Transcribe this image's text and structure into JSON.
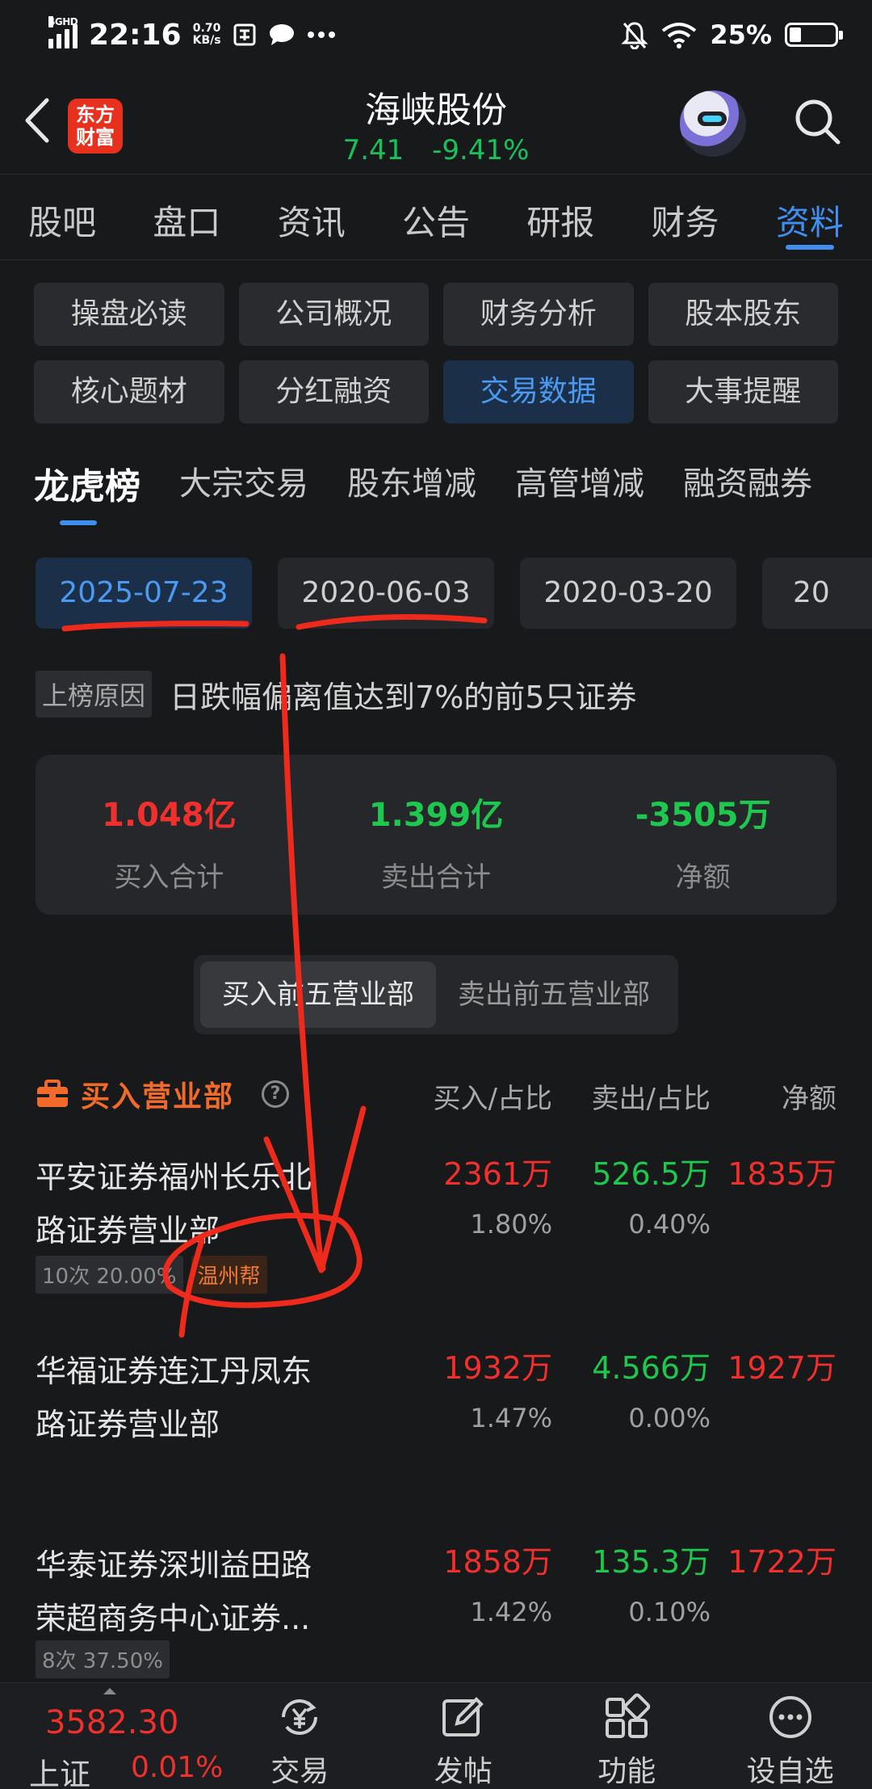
{
  "status_bar": {
    "network": "4GHD",
    "time": "22:16",
    "speed_value": "0.70",
    "speed_unit": "KB/s",
    "battery": "25%",
    "battery_level": 0.25
  },
  "header": {
    "logo_line1": "东方",
    "logo_line2": "财富",
    "title": "海峡股份",
    "price": "7.41",
    "change": "-9.41%"
  },
  "main_tabs": [
    {
      "label": "股吧"
    },
    {
      "label": "盘口"
    },
    {
      "label": "资讯"
    },
    {
      "label": "公告"
    },
    {
      "label": "研报"
    },
    {
      "label": "财务"
    },
    {
      "label": "资料"
    }
  ],
  "sub_menu": [
    {
      "label": "操盘必读"
    },
    {
      "label": "公司概况"
    },
    {
      "label": "财务分析"
    },
    {
      "label": "股本股东"
    },
    {
      "label": "核心题材"
    },
    {
      "label": "分红融资"
    },
    {
      "label": "交易数据"
    },
    {
      "label": "大事提醒"
    }
  ],
  "rank_tabs": [
    {
      "label": "龙虎榜"
    },
    {
      "label": "大宗交易"
    },
    {
      "label": "股东增减"
    },
    {
      "label": "高管增减"
    },
    {
      "label": "融资融券"
    }
  ],
  "dates": [
    {
      "label": "2025-07-23"
    },
    {
      "label": "2020-06-03"
    },
    {
      "label": "2020-03-20"
    },
    {
      "label": "20"
    }
  ],
  "reason": {
    "tag": "上榜原因",
    "text": "日跌幅偏离值达到7%的前5只证券"
  },
  "summary": {
    "buy_total": "1.048亿",
    "buy_label": "买入合计",
    "sell_total": "1.399亿",
    "sell_label": "卖出合计",
    "net": "-3505万",
    "net_label": "净额"
  },
  "toggle": {
    "buy": "买入前五营业部",
    "sell": "卖出前五营业部"
  },
  "table": {
    "title": "买入营业部",
    "help": "?",
    "col_buy": "买入/占比",
    "col_sell": "卖出/占比",
    "col_net": "净额",
    "rows": [
      {
        "name_line1": "平安证券福州长乐北",
        "name_line2": "路证券营业部",
        "buy": "2361万",
        "buy_pct": "1.80%",
        "sell": "526.5万",
        "sell_pct": "0.40%",
        "net": "1835万",
        "tag1": "10次  20.00%",
        "tag2": "温州帮"
      },
      {
        "name_line1": "华福证券连江丹凤东",
        "name_line2": "路证券营业部",
        "buy": "1932万",
        "buy_pct": "1.47%",
        "sell": "4.566万",
        "sell_pct": "0.00%",
        "net": "1927万"
      },
      {
        "name_line1": "华泰证券深圳益田路",
        "name_line2": "荣超商务中心证券...",
        "buy": "1858万",
        "buy_pct": "1.42%",
        "sell": "135.3万",
        "sell_pct": "0.10%",
        "net": "1722万",
        "tag1": "8次  37.50%"
      }
    ]
  },
  "bottom_nav": {
    "index_value": "3582.30",
    "index_name": "上证",
    "index_change": "0.01%",
    "items": [
      {
        "label": "交易"
      },
      {
        "label": "发帖"
      },
      {
        "label": "功能"
      },
      {
        "label": "设自选"
      }
    ]
  }
}
